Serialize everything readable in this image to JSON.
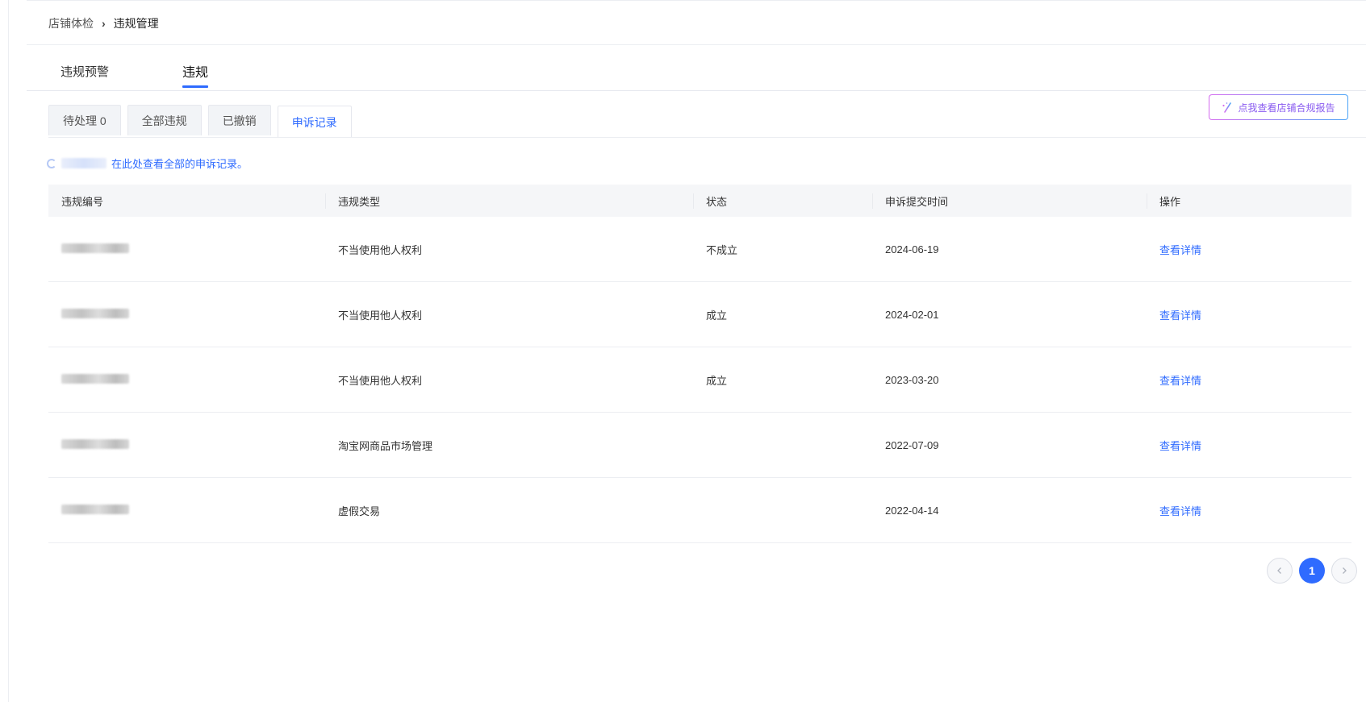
{
  "breadcrumb": {
    "parent": "店铺体检",
    "separator": "›",
    "current": "违规管理"
  },
  "main_tabs": [
    {
      "label": "违规预警",
      "active": false
    },
    {
      "label": "违规",
      "active": true
    }
  ],
  "sub_tabs": [
    {
      "label": "待处理 0",
      "active": false
    },
    {
      "label": "全部违规",
      "active": false
    },
    {
      "label": "已撤销",
      "active": false
    },
    {
      "label": "申诉记录",
      "active": true
    }
  ],
  "report_button": {
    "label": "点我查看店铺合规报告",
    "icon": "sparkle-wand-icon"
  },
  "notice": {
    "text": "在此处查看全部的申诉记录。"
  },
  "table": {
    "headers": [
      "违规编号",
      "违规类型",
      "状态",
      "申诉提交时间",
      "操作"
    ],
    "rows": [
      {
        "type": "不当使用他人权利",
        "status": "不成立",
        "time": "2024-06-19",
        "action": "查看详情"
      },
      {
        "type": "不当使用他人权利",
        "status": "成立",
        "time": "2024-02-01",
        "action": "查看详情"
      },
      {
        "type": "不当使用他人权利",
        "status": "成立",
        "time": "2023-03-20",
        "action": "查看详情"
      },
      {
        "type": "淘宝网商品市场管理",
        "status": "",
        "time": "2022-07-09",
        "action": "查看详情"
      },
      {
        "type": "虚假交易",
        "status": "",
        "time": "2022-04-14",
        "action": "查看详情"
      }
    ]
  },
  "pagination": {
    "current_page": "1",
    "prev_icon": "chevron-left-icon",
    "next_icon": "chevron-right-icon"
  },
  "colors": {
    "accent": "#2f6bff",
    "header_bg": "#f5f6f8",
    "gradient_start": "#d56bf0",
    "gradient_end": "#4aa3f7"
  }
}
